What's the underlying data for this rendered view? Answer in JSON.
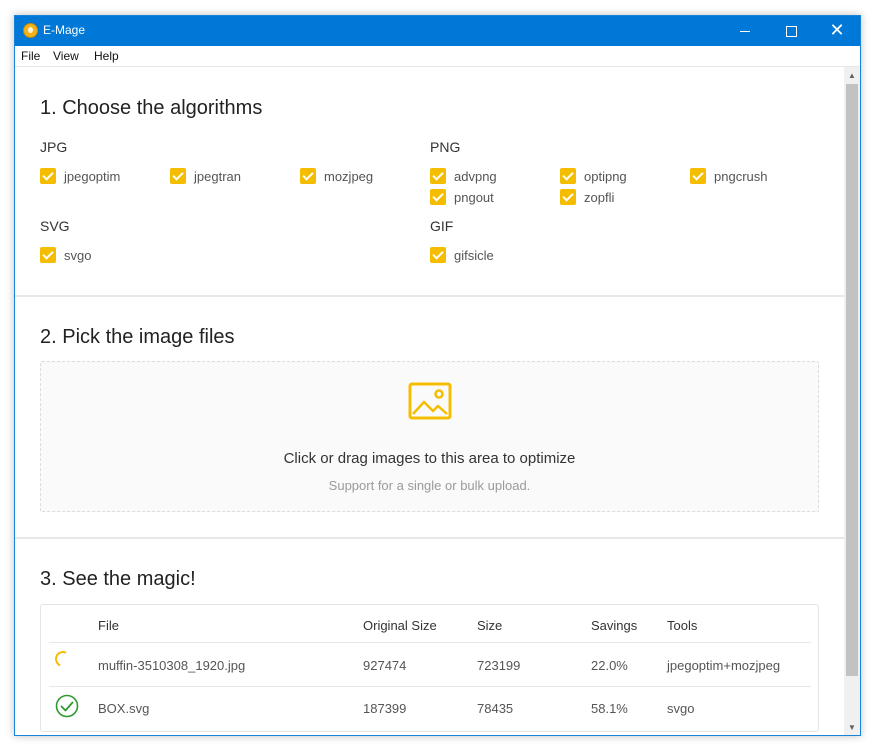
{
  "window": {
    "title": "E-Mage",
    "controls": {
      "minimize": "minimize",
      "maximize": "maximize",
      "close": "close"
    }
  },
  "menu": [
    "File",
    "View",
    "Help"
  ],
  "section1": {
    "title": "1. Choose the algorithms",
    "groups": {
      "jpg": {
        "label": "JPG",
        "options": [
          "jpegoptim",
          "jpegtran",
          "mozjpeg"
        ]
      },
      "png": {
        "label": "PNG",
        "options": [
          "advpng",
          "optipng",
          "pngcrush",
          "pngout",
          "zopfli"
        ]
      },
      "svg": {
        "label": "SVG",
        "options": [
          "svgo"
        ]
      },
      "gif": {
        "label": "GIF",
        "options": [
          "gifsicle"
        ]
      }
    },
    "all_checked": true
  },
  "section2": {
    "title": "2. Pick the image files",
    "dropzone": {
      "icon": "picture-icon",
      "text": "Click or drag images to this area to optimize",
      "hint": "Support for a single or bulk upload."
    }
  },
  "section3": {
    "title": "3. See the magic!",
    "columns": [
      "File",
      "Original Size",
      "Size",
      "Savings",
      "Tools"
    ],
    "rows": [
      {
        "status": "loading",
        "file": "muffin-3510308_1920.jpg",
        "original": "927474",
        "size": "723199",
        "savings": "22.0%",
        "tools": "jpegoptim+mozjpeg"
      },
      {
        "status": "done",
        "file": "BOX.svg",
        "original": "187399",
        "size": "78435",
        "savings": "58.1%",
        "tools": "svgo"
      }
    ]
  },
  "colors": {
    "titlebar": "#0078d7",
    "accent": "#f5bd00",
    "success": "#2e9a2e"
  }
}
